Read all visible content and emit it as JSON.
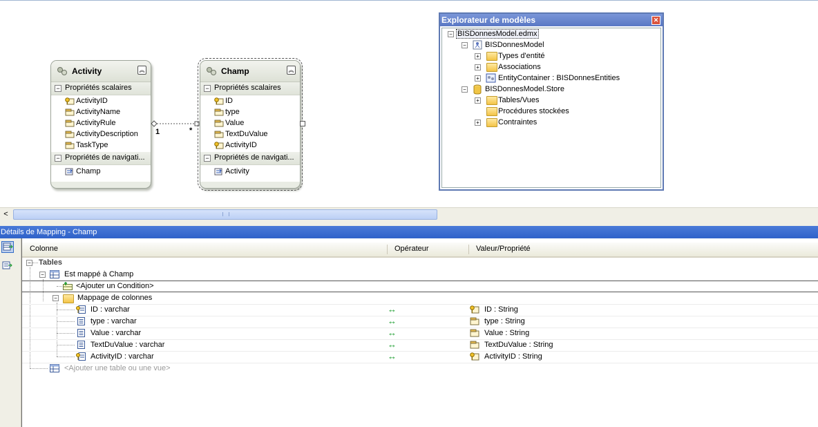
{
  "designer": {
    "entities": [
      {
        "name": "Activity",
        "scalar_header": "Propriétés scalaires",
        "properties": [
          "ActivityID",
          "ActivityName",
          "ActivityRule",
          "ActivityDescription",
          "TaskType"
        ],
        "key_properties": [
          "ActivityID"
        ],
        "nav_header": "Propriétés de navigati...",
        "nav_properties": [
          "Champ"
        ]
      },
      {
        "name": "Champ",
        "scalar_header": "Propriétés scalaires",
        "properties": [
          "ID",
          "type",
          "Value",
          "TextDuValue",
          "ActivityID"
        ],
        "key_properties": [
          "ID",
          "ActivityID"
        ],
        "nav_header": "Propriétés de navigati...",
        "nav_properties": [
          "Activity"
        ]
      }
    ],
    "association": {
      "left_multiplicity": "1",
      "right_multiplicity": "*"
    }
  },
  "model_browser": {
    "title": "Explorateur de modèles",
    "items": [
      {
        "label": "BISDonnesModel.edmx",
        "level": 0,
        "expander": "-",
        "selected": true,
        "icon": "none"
      },
      {
        "label": "BISDonnesModel",
        "level": 1,
        "expander": "-",
        "icon": "conceptual-model-icon"
      },
      {
        "label": "Types d'entité",
        "level": 2,
        "expander": "+",
        "icon": "folder-icon"
      },
      {
        "label": "Associations",
        "level": 2,
        "expander": "+",
        "icon": "folder-icon"
      },
      {
        "label": "EntityContainer : BISDonnesEntities",
        "level": 2,
        "expander": "+",
        "icon": "entity-container-icon"
      },
      {
        "label": "BISDonnesModel.Store",
        "level": 1,
        "expander": "-",
        "icon": "database-icon"
      },
      {
        "label": "Tables/Vues",
        "level": 2,
        "expander": "+",
        "icon": "folder-icon"
      },
      {
        "label": "Procédures stockées",
        "level": 2,
        "expander": "",
        "icon": "folder-icon"
      },
      {
        "label": "Contraintes",
        "level": 2,
        "expander": "+",
        "icon": "folder-icon"
      }
    ]
  },
  "mapping": {
    "title": "Détails de Mapping - Champ",
    "columns": [
      "Colonne",
      "Opérateur",
      "Valeur/Propriété"
    ],
    "tables_label": "Tables",
    "maps_to": "Est mappé à Champ",
    "add_condition": "<Ajouter un Condition>",
    "column_mappings_label": "Mappage de colonnes",
    "operator_symbol": "↔",
    "rows": [
      {
        "column": "ID : varchar",
        "property": "ID : String",
        "key": true
      },
      {
        "column": "type : varchar",
        "property": "type : String",
        "key": false
      },
      {
        "column": "Value : varchar",
        "property": "Value : String",
        "key": false
      },
      {
        "column": "TextDuValue : varchar",
        "property": "TextDuValue : String",
        "key": false
      },
      {
        "column": "ActivityID : varchar",
        "property": "ActivityID : String",
        "key": true
      }
    ],
    "add_table": "<Ajouter une table ou une vue>"
  },
  "colors": {
    "panel_header": "#2f62c9",
    "browser_border": "#5e79b3",
    "entity_fill": "#e9ece4",
    "operator_green": "#1a9c2c"
  }
}
